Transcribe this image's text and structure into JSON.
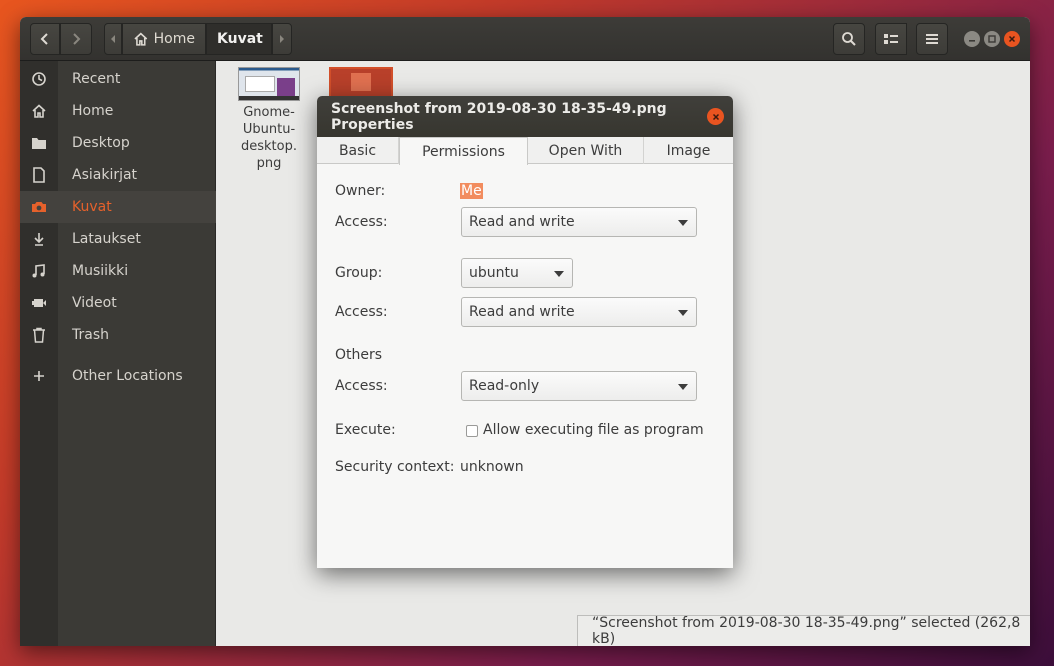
{
  "headerbar": {
    "back_icon": "chevron-left-icon",
    "forward_icon": "chevron-right-icon",
    "crumbs": [
      {
        "label": "Home",
        "icon": "home-icon"
      },
      {
        "label": "Kuvat"
      }
    ],
    "search_icon": "search-icon",
    "view_icon": "list-view-icon",
    "menu_icon": "hamburger-menu-icon"
  },
  "sidebar": {
    "items": [
      {
        "label": "Recent",
        "icon": "clock-icon"
      },
      {
        "label": "Home",
        "icon": "home-icon"
      },
      {
        "label": "Desktop",
        "icon": "folder-icon"
      },
      {
        "label": "Asiakirjat",
        "icon": "document-icon"
      },
      {
        "label": "Kuvat",
        "icon": "camera-icon"
      },
      {
        "label": "Lataukset",
        "icon": "download-icon"
      },
      {
        "label": "Musiikki",
        "icon": "music-icon"
      },
      {
        "label": "Videot",
        "icon": "video-icon"
      },
      {
        "label": "Trash",
        "icon": "trash-icon"
      },
      {
        "label": "Other Locations",
        "icon": "plus-icon"
      }
    ]
  },
  "files": [
    {
      "name_lines": [
        "Gnome-",
        "Ubuntu-",
        "desktop.",
        "png"
      ]
    }
  ],
  "statusbar": {
    "text": "“Screenshot from 2019-08-30 18-35-49.png” selected  (262,8 kB)"
  },
  "dialog": {
    "title": "Screenshot from 2019-08-30 18-35-49.png Properties",
    "tabs": [
      "Basic",
      "Permissions",
      "Open With",
      "Image"
    ],
    "owner_label": "Owner:",
    "owner_value": "Me",
    "owner_access_label": "Access:",
    "owner_access_value": "Read and write",
    "group_label": "Group:",
    "group_value": "ubuntu",
    "group_access_label": "Access:",
    "group_access_value": "Read and write",
    "others_label": "Others",
    "others_access_label": "Access:",
    "others_access_value": "Read-only",
    "execute_label": "Execute:",
    "execute_checkbox_label": "Allow executing file as program",
    "security_label": "Security context:",
    "security_value": "unknown"
  },
  "colors": {
    "accent": "#e95420",
    "sidebar_bg": "#3b3a36",
    "headerbar_bg": "#3d3c38"
  }
}
